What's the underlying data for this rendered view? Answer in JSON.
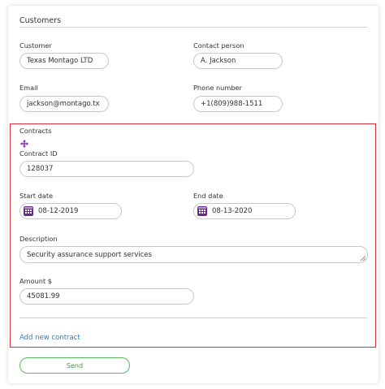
{
  "form": {
    "title": "Customers",
    "customer": {
      "label": "Customer",
      "value": "Texas Montago LTD"
    },
    "contact_person": {
      "label": "Contact person",
      "value": "A. Jackson"
    },
    "email": {
      "label": "Email",
      "value": "jackson@montago.tx"
    },
    "phone": {
      "label": "Phone number",
      "value": "+1(809)988-1511"
    }
  },
  "contracts": {
    "title": "Contracts",
    "contract_id": {
      "label": "Contract ID",
      "value": "128037"
    },
    "start_date": {
      "label": "Start date",
      "value": "08-12-2019"
    },
    "end_date": {
      "label": "End date",
      "value": "08-13-2020"
    },
    "description": {
      "label": "Description",
      "value": "Security assurance support services"
    },
    "amount": {
      "label": "Amount $",
      "value": "45081.99"
    },
    "add_link": "Add new contract",
    "highlight_color": "#d9303a",
    "icons": {
      "move": "move-arrows-icon",
      "calendar": "calendar-icon"
    }
  },
  "actions": {
    "send_label": "Send",
    "send_color": "#5cb85c"
  }
}
